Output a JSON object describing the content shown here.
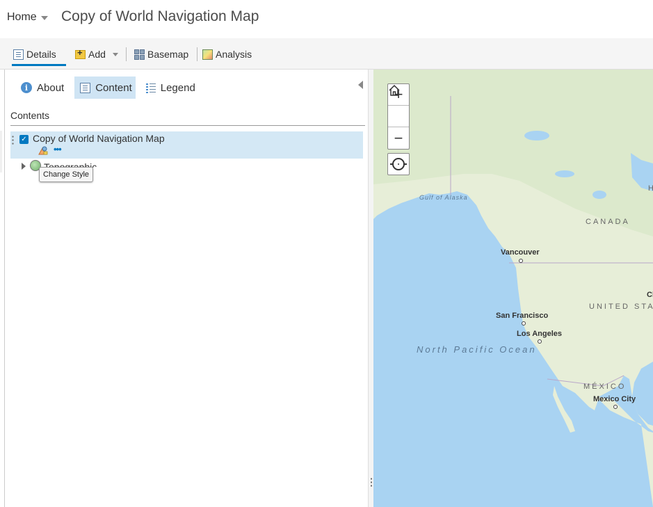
{
  "header": {
    "home_label": "Home",
    "map_title": "Copy of World Navigation Map"
  },
  "toolbar": {
    "details_label": "Details",
    "add_label": "Add",
    "basemap_label": "Basemap",
    "analysis_label": "Analysis"
  },
  "panel_tabs": {
    "about_label": "About",
    "content_label": "Content",
    "legend_label": "Legend",
    "active": "Content"
  },
  "contents": {
    "heading": "Contents",
    "layer": {
      "name": "Copy of World Navigation Map",
      "checked": true
    },
    "basemap_layer": {
      "name": "Topographic"
    },
    "tooltip": "Change Style"
  },
  "map": {
    "zoom_in": "+",
    "zoom_out": "−",
    "labels": {
      "gulf": "Gulf of Alaska",
      "canada": "CANADA",
      "usa": "UNITED STATES",
      "mexico": "MÉXICO",
      "ocean": "North Pacific Ocean",
      "vancouver": "Vancouver",
      "san_francisco": "San Francisco",
      "los_angeles": "Los Angeles",
      "mexico_city": "Mexico City",
      "partial_h": "H",
      "partial_cl": "Cl"
    }
  },
  "colors": {
    "accent": "#0079c1",
    "selection": "#d4e8f5",
    "ocean": "#a9d3f2",
    "land": "#e9efdc"
  }
}
